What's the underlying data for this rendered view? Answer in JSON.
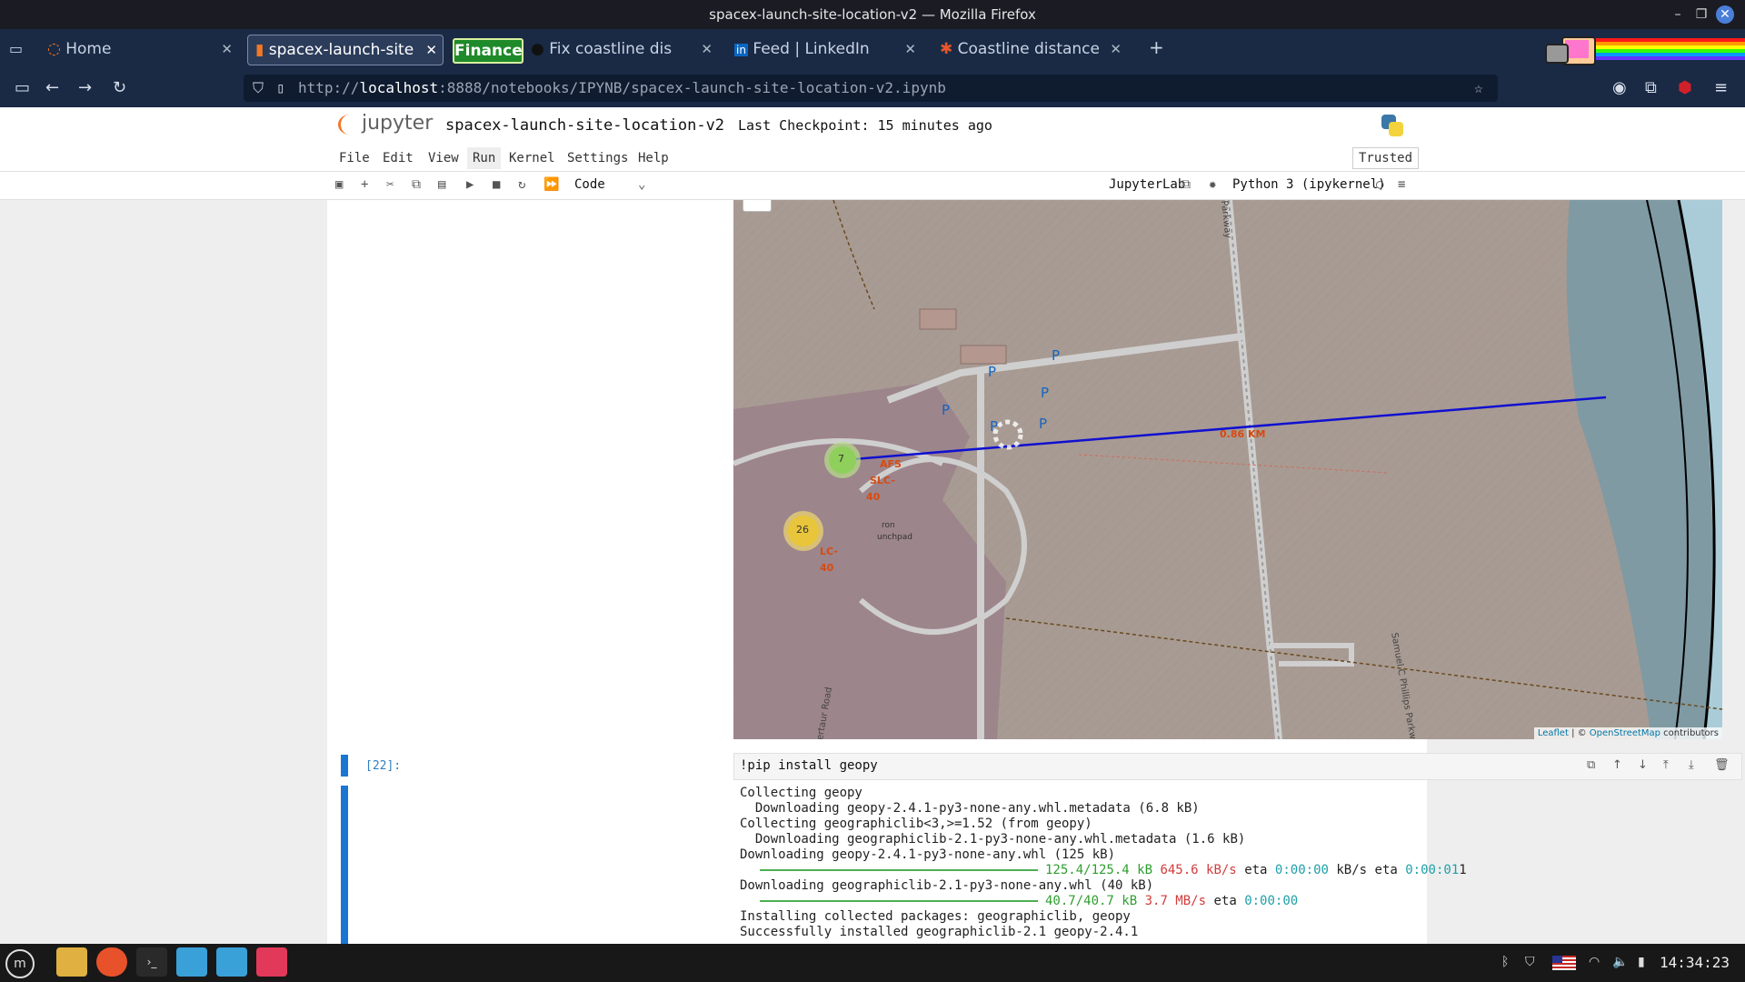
{
  "window": {
    "title": "spacex-launch-site-location-v2 — Mozilla Firefox"
  },
  "tabs": [
    {
      "label": "Home",
      "active": false
    },
    {
      "label": "spacex-launch-site",
      "active": true
    },
    {
      "label": "Finance",
      "active": false
    },
    {
      "label": "Fix coastline dis",
      "active": false
    },
    {
      "label": "Feed | LinkedIn",
      "active": false
    },
    {
      "label": "Coastline distance",
      "active": false
    }
  ],
  "nav": {
    "url_prefix": "http://",
    "url_host": "localhost",
    "url_rest": ":8888/notebooks/IPYNB/spacex-launch-site-location-v2.ipynb"
  },
  "jupyter": {
    "logo_text": "jupyter",
    "notebook_name": "spacex-launch-site-location-v2",
    "checkpoint": "Last Checkpoint: 15 minutes ago",
    "trusted": "Trusted",
    "menu": [
      "File",
      "Edit",
      "View",
      "Run",
      "Kernel",
      "Settings",
      "Help"
    ],
    "cell_type": "Code",
    "jupyterlab_link": "JupyterLab",
    "kernel": "Python 3 (ipykernel)"
  },
  "map": {
    "distance_label": "0.86 KM",
    "cluster_small": "7",
    "cluster_large": "26",
    "labels": [
      "AFS",
      "SLC-",
      "40",
      "LC-",
      "40",
      "Parkway",
      "Samuel C Phillips Parkway",
      "ertaur Road",
      "ron",
      "unchpad"
    ],
    "parking": [
      "P",
      "P",
      "P",
      "P",
      "P",
      "P"
    ],
    "attribution_leaflet": "Leaflet",
    "attribution_sep": " | © ",
    "attribution_osm": "OpenStreetMap",
    "attribution_tail": " contributors",
    "colors": {
      "line": "#1010d0",
      "land": "#a89b93",
      "restricted": "#9a7d8a",
      "sea": "#7f9aa3",
      "sea_light": "#a9ccd8",
      "cluster_green": "#8fcf5c",
      "cluster_yellow": "#e8c53a"
    }
  },
  "cell22": {
    "prompt": "[22]:",
    "source": "!pip install geopy",
    "output": {
      "l1": "Collecting geopy",
      "l2": "  Downloading geopy-2.4.1-py3-none-any.whl.metadata (6.8 kB)",
      "l3": "Collecting geographiclib<3,>=1.52 (from geopy)",
      "l4": "  Downloading geographiclib-2.1-py3-none-any.whl.metadata (1.6 kB)",
      "l5": "Downloading geopy-2.4.1-py3-none-any.whl (125 kB)",
      "p1_size": "125.4/125.4 kB",
      "p1_speed": "645.6 kB/s",
      "p1_eta": "eta",
      "p1_time": "0:00:00",
      "p1_extra": "kB/s eta",
      "p1_time2": "0:00:01",
      "p1_tail": "1",
      "l7": "Downloading geographiclib-2.1-py3-none-any.whl (40 kB)",
      "p2_size": "40.7/40.7 kB",
      "p2_speed": "3.7 MB/s",
      "p2_eta": "eta",
      "p2_time": "0:00:00",
      "l9": "Installing collected packages: geographiclib, geopy",
      "l10": "Successfully installed geographiclib-2.1 geopy-2.4.1"
    }
  },
  "taskbar": {
    "clock": "14:34:23"
  }
}
